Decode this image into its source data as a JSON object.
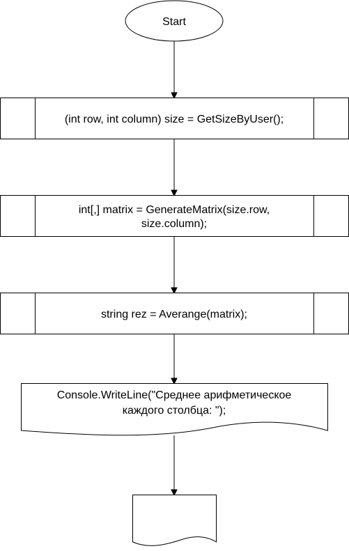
{
  "flowchart": {
    "start": {
      "label": "Start"
    },
    "step_get_size": {
      "label": "(int row, int column) size = GetSizeByUser();"
    },
    "step_generate_matrix": {
      "line1": "int[,] matrix = GenerateMatrix(size.row,",
      "line2": "size.column);"
    },
    "step_average": {
      "label": "string rez = Averange(matrix);"
    },
    "step_output": {
      "line1": "Console.WriteLine(\"Среднее арифметическое",
      "line2": "каждого столбца: \");"
    },
    "end_document": {
      "label": ""
    }
  }
}
